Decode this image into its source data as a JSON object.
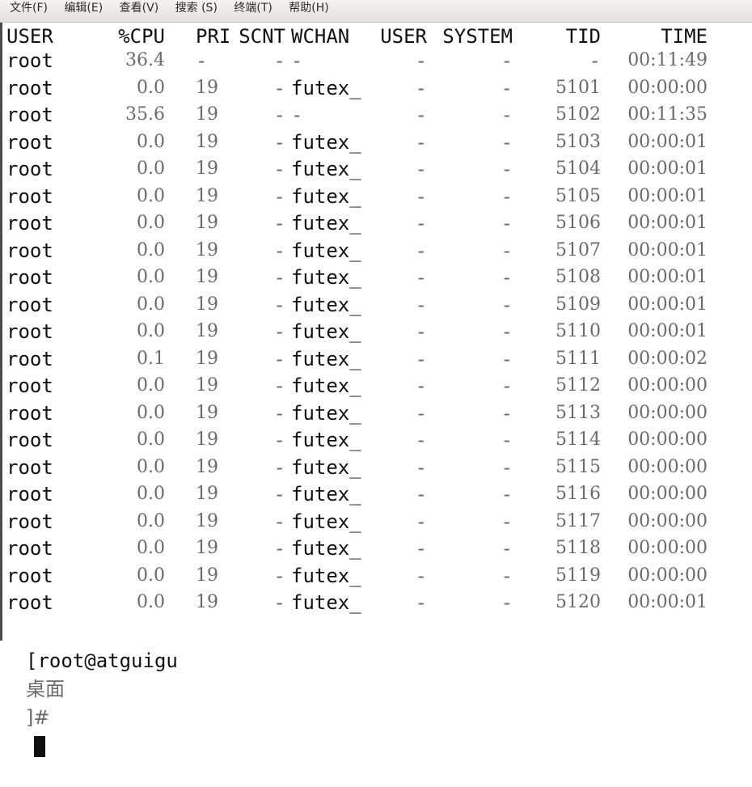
{
  "menu": [
    "文件(F)",
    "编辑(E)",
    "查看(V)",
    "搜索 (S)",
    "终端(T)",
    "帮助(H)"
  ],
  "columns": [
    "USER",
    "%CPU",
    "PRI",
    "SCNT",
    "WCHAN",
    "USER",
    "SYSTEM",
    "TID",
    "TIME"
  ],
  "rows": [
    {
      "user": "root",
      "cpu": "36.4",
      "pri": "-",
      "scnt": "-",
      "wchan": "-",
      "usr": "-",
      "sys": "-",
      "tid": "-",
      "time": "00:11:49"
    },
    {
      "user": "root",
      "cpu": "0.0",
      "pri": "19",
      "scnt": "-",
      "wchan": "futex_",
      "usr": "-",
      "sys": "-",
      "tid": "5101",
      "time": "00:00:00"
    },
    {
      "user": "root",
      "cpu": "35.6",
      "pri": "19",
      "scnt": "-",
      "wchan": "-",
      "usr": "-",
      "sys": "-",
      "tid": "5102",
      "time": "00:11:35"
    },
    {
      "user": "root",
      "cpu": "0.0",
      "pri": "19",
      "scnt": "-",
      "wchan": "futex_",
      "usr": "-",
      "sys": "-",
      "tid": "5103",
      "time": "00:00:01"
    },
    {
      "user": "root",
      "cpu": "0.0",
      "pri": "19",
      "scnt": "-",
      "wchan": "futex_",
      "usr": "-",
      "sys": "-",
      "tid": "5104",
      "time": "00:00:01"
    },
    {
      "user": "root",
      "cpu": "0.0",
      "pri": "19",
      "scnt": "-",
      "wchan": "futex_",
      "usr": "-",
      "sys": "-",
      "tid": "5105",
      "time": "00:00:01"
    },
    {
      "user": "root",
      "cpu": "0.0",
      "pri": "19",
      "scnt": "-",
      "wchan": "futex_",
      "usr": "-",
      "sys": "-",
      "tid": "5106",
      "time": "00:00:01"
    },
    {
      "user": "root",
      "cpu": "0.0",
      "pri": "19",
      "scnt": "-",
      "wchan": "futex_",
      "usr": "-",
      "sys": "-",
      "tid": "5107",
      "time": "00:00:01"
    },
    {
      "user": "root",
      "cpu": "0.0",
      "pri": "19",
      "scnt": "-",
      "wchan": "futex_",
      "usr": "-",
      "sys": "-",
      "tid": "5108",
      "time": "00:00:01"
    },
    {
      "user": "root",
      "cpu": "0.0",
      "pri": "19",
      "scnt": "-",
      "wchan": "futex_",
      "usr": "-",
      "sys": "-",
      "tid": "5109",
      "time": "00:00:01"
    },
    {
      "user": "root",
      "cpu": "0.0",
      "pri": "19",
      "scnt": "-",
      "wchan": "futex_",
      "usr": "-",
      "sys": "-",
      "tid": "5110",
      "time": "00:00:01"
    },
    {
      "user": "root",
      "cpu": "0.1",
      "pri": "19",
      "scnt": "-",
      "wchan": "futex_",
      "usr": "-",
      "sys": "-",
      "tid": "5111",
      "time": "00:00:02"
    },
    {
      "user": "root",
      "cpu": "0.0",
      "pri": "19",
      "scnt": "-",
      "wchan": "futex_",
      "usr": "-",
      "sys": "-",
      "tid": "5112",
      "time": "00:00:00"
    },
    {
      "user": "root",
      "cpu": "0.0",
      "pri": "19",
      "scnt": "-",
      "wchan": "futex_",
      "usr": "-",
      "sys": "-",
      "tid": "5113",
      "time": "00:00:00"
    },
    {
      "user": "root",
      "cpu": "0.0",
      "pri": "19",
      "scnt": "-",
      "wchan": "futex_",
      "usr": "-",
      "sys": "-",
      "tid": "5114",
      "time": "00:00:00"
    },
    {
      "user": "root",
      "cpu": "0.0",
      "pri": "19",
      "scnt": "-",
      "wchan": "futex_",
      "usr": "-",
      "sys": "-",
      "tid": "5115",
      "time": "00:00:00"
    },
    {
      "user": "root",
      "cpu": "0.0",
      "pri": "19",
      "scnt": "-",
      "wchan": "futex_",
      "usr": "-",
      "sys": "-",
      "tid": "5116",
      "time": "00:00:00"
    },
    {
      "user": "root",
      "cpu": "0.0",
      "pri": "19",
      "scnt": "-",
      "wchan": "futex_",
      "usr": "-",
      "sys": "-",
      "tid": "5117",
      "time": "00:00:00"
    },
    {
      "user": "root",
      "cpu": "0.0",
      "pri": "19",
      "scnt": "-",
      "wchan": "futex_",
      "usr": "-",
      "sys": "-",
      "tid": "5118",
      "time": "00:00:00"
    },
    {
      "user": "root",
      "cpu": "0.0",
      "pri": "19",
      "scnt": "-",
      "wchan": "futex_",
      "usr": "-",
      "sys": "-",
      "tid": "5119",
      "time": "00:00:00"
    },
    {
      "user": "root",
      "cpu": "0.0",
      "pri": "19",
      "scnt": "-",
      "wchan": "futex_",
      "usr": "-",
      "sys": "-",
      "tid": "5120",
      "time": "00:00:01"
    }
  ],
  "prompt": {
    "host": "[root@atguigu",
    "dir": "桌面",
    "tail": "]#"
  }
}
